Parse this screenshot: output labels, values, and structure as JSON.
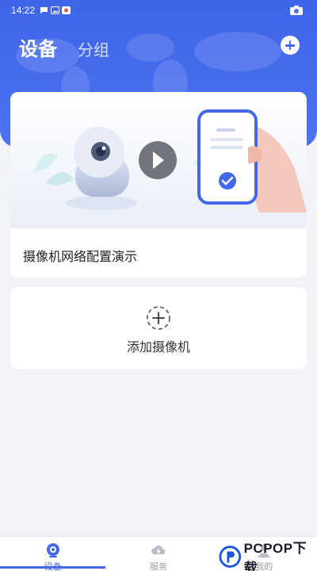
{
  "status_bar": {
    "time": "14:22"
  },
  "header": {
    "tabs": [
      {
        "label": "设备",
        "active": true
      },
      {
        "label": "分组",
        "active": false
      }
    ],
    "accent_color": "#4368ec"
  },
  "demo_card": {
    "title": "摄像机网络配置演示"
  },
  "add_card": {
    "label": "添加摄像机"
  },
  "bottom_nav": {
    "items": [
      {
        "label": "设备",
        "icon": "camera-icon",
        "active": true
      },
      {
        "label": "服务",
        "icon": "cloud-icon",
        "active": false
      },
      {
        "label": "我的",
        "icon": "user-icon",
        "active": false
      }
    ]
  },
  "watermark": {
    "text": "PCPOP下载"
  }
}
